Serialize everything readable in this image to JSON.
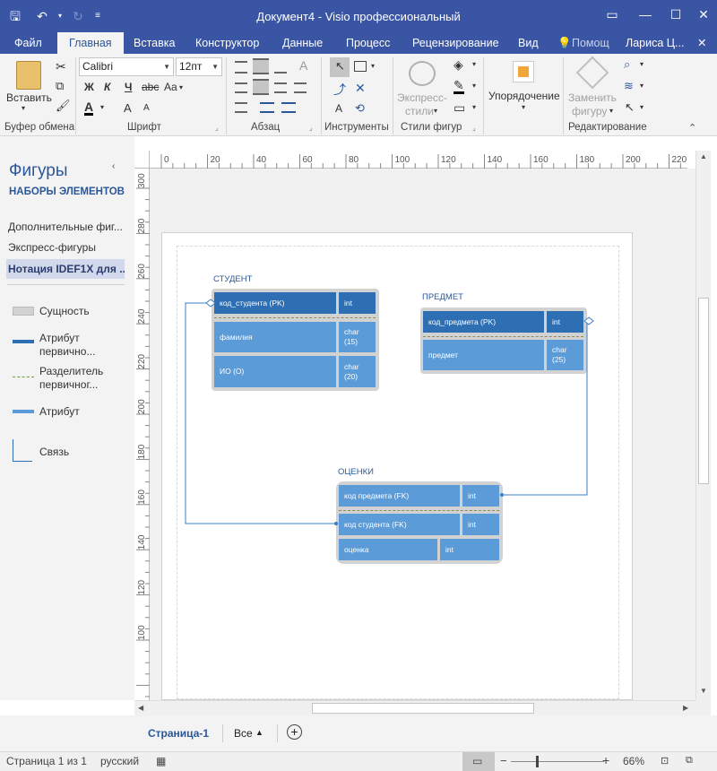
{
  "titlebar": {
    "title": "Документ4 - Visio профессиональный",
    "save_icon": "save-icon",
    "undo_icon": "undo-icon",
    "redo_icon": "redo-icon",
    "customize_icon": "customize-quick-access-icon"
  },
  "tabs": [
    {
      "label": "Файл"
    },
    {
      "label": "Главная",
      "active": true
    },
    {
      "label": "Вставка"
    },
    {
      "label": "Конструктор"
    },
    {
      "label": "Данные"
    },
    {
      "label": "Процесс"
    },
    {
      "label": "Рецензирование"
    },
    {
      "label": "Вид"
    }
  ],
  "tell_me": "Помощ",
  "user": "Лариса Ц...",
  "ribbon": {
    "clipboard": {
      "paste": "Вставить",
      "label": "Буфер обмена"
    },
    "font": {
      "name": "Calibri",
      "size": "12пт",
      "bold": "Ж",
      "italic": "К",
      "underline": "Ч",
      "strike": "abc",
      "case": "Aa",
      "color": "A",
      "grow": "A",
      "shrink": "A",
      "label": "Шрифт"
    },
    "paragraph": {
      "label": "Абзац"
    },
    "tools": {
      "text": "A",
      "label": "Инструменты"
    },
    "shape_styles": {
      "express_line1": "Экспресс-",
      "express_line2": "стили",
      "label": "Стили фигур"
    },
    "arrange": {
      "label": "Упорядочение"
    },
    "editing": {
      "replace_line1": "Заменить",
      "replace_line2": "фигуру",
      "label": "Редактирование"
    }
  },
  "shapes_panel": {
    "title": "Фигуры",
    "subtitle": "НАБОРЫ ЭЛЕМЕНТОВ",
    "stencils": [
      "Дополнительные фиг...",
      "Экспресс-фигуры",
      "Нотация IDEF1X для ..."
    ],
    "items": [
      {
        "line1": "Сущность",
        "line2": ""
      },
      {
        "line1": "Атрибут",
        "line2": "первично..."
      },
      {
        "line1": "Разделитель",
        "line2": "первичног..."
      },
      {
        "line1": "Атрибут",
        "line2": ""
      },
      {
        "line1": "Связь",
        "line2": ""
      }
    ]
  },
  "ruler_h": [
    "0",
    "20",
    "40",
    "60",
    "80",
    "100",
    "120",
    "140",
    "160",
    "180",
    "200",
    "220"
  ],
  "ruler_v": [
    "300",
    "280",
    "260",
    "240",
    "220",
    "200",
    "180",
    "160",
    "140",
    "120",
    "100"
  ],
  "entities": {
    "student": {
      "title": "СТУДЕНТ",
      "pk": [
        {
          "name": "код_студента (PK)",
          "type": "int"
        }
      ],
      "attrs": [
        {
          "name": "фамилия",
          "type": "char\n(15)"
        },
        {
          "name": "ИО (О)",
          "type": "char\n(20)"
        }
      ]
    },
    "subject": {
      "title": "ПРЕДМЕТ",
      "pk": [
        {
          "name": "код_предмета (PK)",
          "type": "int"
        }
      ],
      "attrs": [
        {
          "name": "предмет",
          "type": "char\n(25)"
        }
      ]
    },
    "grades": {
      "title": "ОЦЕНКИ",
      "pk": [
        {
          "name": "код предмета (FK)",
          "type": "int"
        },
        {
          "name": "код студента (FK)",
          "type": "int"
        }
      ],
      "attrs": [
        {
          "name": "оценка",
          "type": "int"
        }
      ]
    }
  },
  "page_tabs": {
    "current": "Страница-1",
    "all": "Все"
  },
  "status": {
    "page": "Страница 1 из 1",
    "language": "русский",
    "zoom": "66%"
  }
}
